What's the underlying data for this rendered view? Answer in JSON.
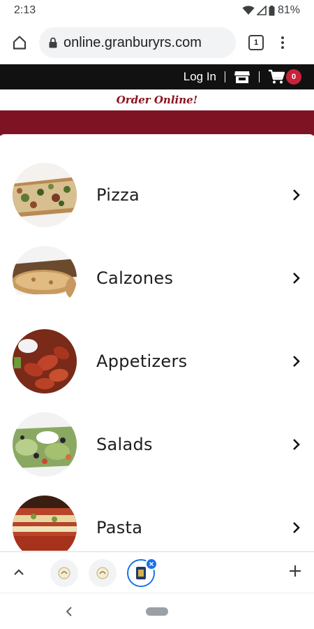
{
  "status_bar": {
    "time": "2:13",
    "battery": "81%"
  },
  "browser": {
    "url": "online.granburyrs.com",
    "tab_count": "1"
  },
  "site_header": {
    "login_label": "Log In",
    "cart_count": "0",
    "tagline": "Order Online!"
  },
  "menu": {
    "items": [
      {
        "label": "Pizza",
        "image": "pizza-photo"
      },
      {
        "label": "Calzones",
        "image": "calzone-photo"
      },
      {
        "label": "Appetizers",
        "image": "wings-photo"
      },
      {
        "label": "Salads",
        "image": "salad-photo"
      },
      {
        "label": "Pasta",
        "image": "pasta-photo"
      }
    ]
  },
  "colors": {
    "brand_red": "#7e1423",
    "cart_badge": "#c8233a",
    "active_tab": "#1a73e8"
  }
}
